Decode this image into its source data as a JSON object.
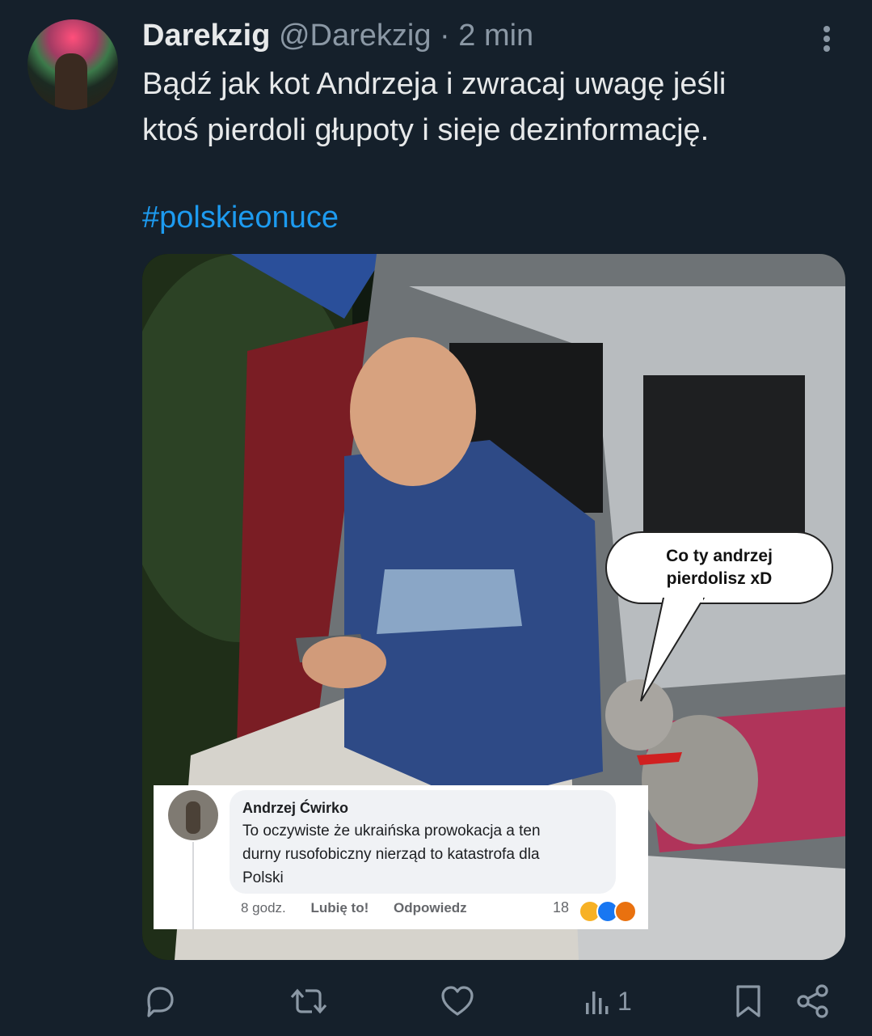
{
  "tweet": {
    "display_name": "Darekzig",
    "handle": "@Darekzig",
    "separator": "·",
    "time": "2 min",
    "text_line1": "Bądź jak kot Andrzeja i zwracaj uwagę jeśli",
    "text_line2": "ktoś pierdoli głupoty i sieje dezinformację.",
    "hashtag": "#polskieonuce"
  },
  "media": {
    "speech_bubble_line1": "Co ty andrzej",
    "speech_bubble_line2": "pierdolisz xD",
    "fb_comment": {
      "author": "Andrzej Ćwirko",
      "text_line1": "To oczywiste że ukraińska prowokacja a ten",
      "text_line2": "durny rusofobiczny nierząd to katastrofa dla",
      "text_line3": "Polski",
      "time": "8 godz.",
      "like_label": "Lubię to!",
      "reply_label": "Odpowiedz",
      "reaction_count": "18",
      "reaction_icons": [
        "laugh-reaction-icon",
        "like-reaction-icon",
        "angry-reaction-icon"
      ]
    }
  },
  "actions": {
    "reply_icon": "reply-icon",
    "retweet_icon": "retweet-icon",
    "like_icon": "heart-icon",
    "views_icon": "views-icon",
    "view_count": "1",
    "bookmark_icon": "bookmark-icon",
    "share_icon": "share-icon"
  },
  "colors": {
    "background": "#15202b",
    "hashtag": "#1d9bf0",
    "secondary_text": "#8b98a5"
  }
}
